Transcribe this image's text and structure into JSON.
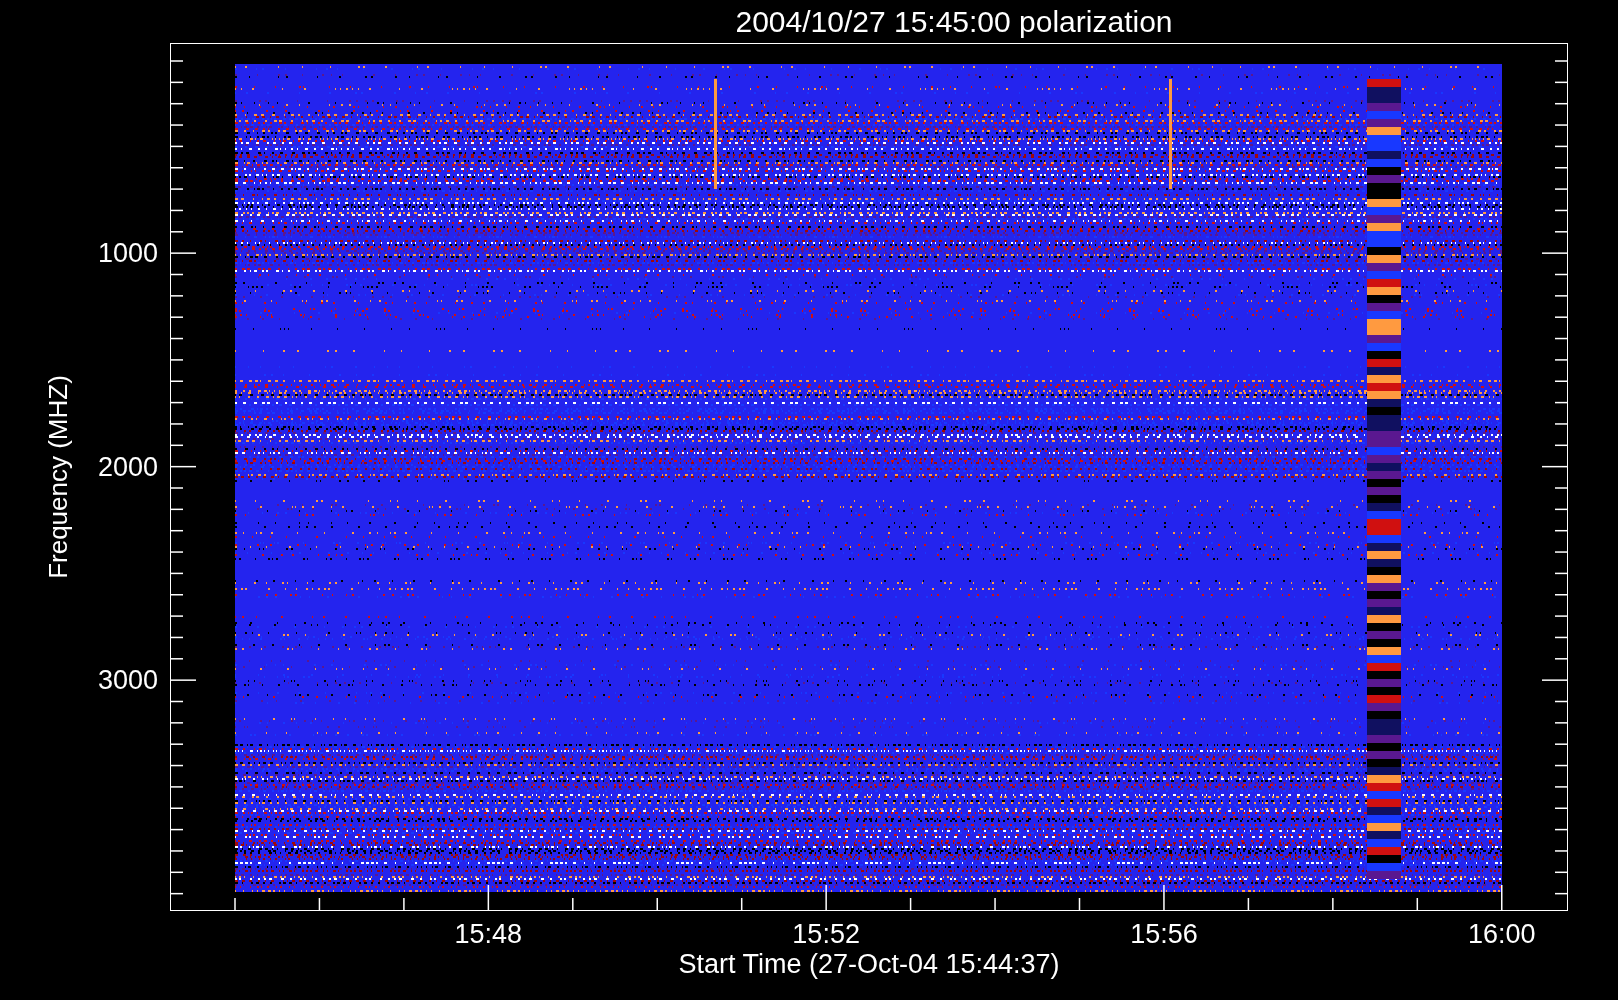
{
  "title": "2004/10/27 15:45:00 polarization",
  "y_axis": {
    "label": "Frequency (MHZ)",
    "ticks": [
      "1000",
      "2000",
      "3000"
    ]
  },
  "x_axis": {
    "label": "Start Time (27-Oct-04 15:44:37)",
    "ticks": [
      "15:48",
      "15:52",
      "15:56",
      "16:00"
    ]
  }
}
